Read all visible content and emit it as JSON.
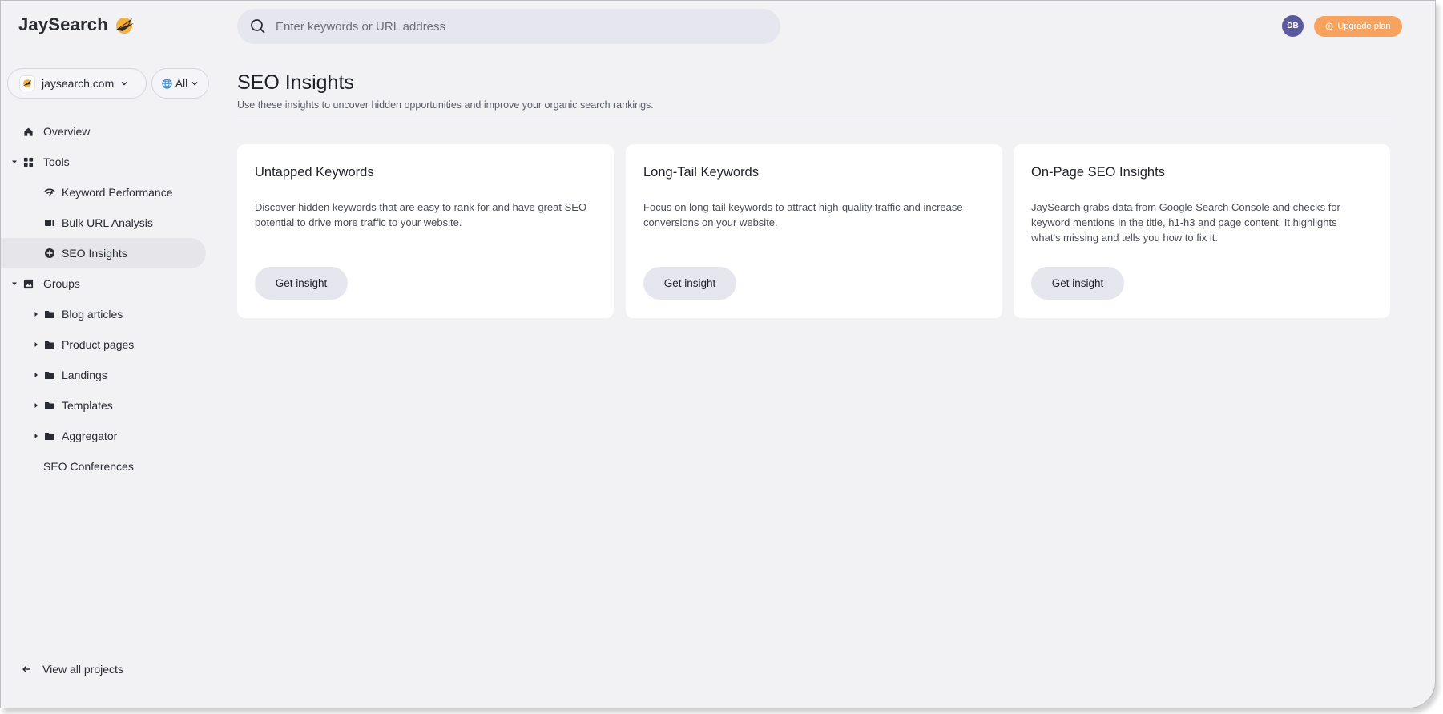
{
  "app": {
    "name": "JaySearch"
  },
  "project_selector": {
    "value": "jaysearch.com"
  },
  "region_selector": {
    "value": "All"
  },
  "search": {
    "placeholder": "Enter keywords or URL address"
  },
  "user": {
    "initials": "DB"
  },
  "upgrade": {
    "label": "Upgrade plan"
  },
  "nav": {
    "overview": "Overview",
    "tools": "Tools",
    "keyword_performance": "Keyword Performance",
    "bulk_url_analysis": "Bulk URL Analysis",
    "seo_insights": "SEO Insights",
    "groups": "Groups",
    "blog_articles": "Blog articles",
    "product_pages": "Product pages",
    "landings": "Landings",
    "templates": "Templates",
    "aggregator": "Aggregator",
    "seo_conferences": "SEO Conferences",
    "view_all_projects": "View all projects"
  },
  "page": {
    "title": "SEO Insights",
    "subtitle": "Use these insights to uncover hidden opportunities and improve your organic search rankings."
  },
  "cards": [
    {
      "title": "Untapped Keywords",
      "description": "Discover hidden keywords that are easy to rank for and have great SEO potential to drive more traffic to your website.",
      "button": "Get insight"
    },
    {
      "title": "Long-Tail Keywords",
      "description": "Focus on long-tail keywords to attract high-quality traffic and increase conversions on your website.",
      "button": "Get insight"
    },
    {
      "title": "On-Page SEO Insights",
      "description": "JaySearch grabs data from Google Search Console and checks for keyword mentions in the title, h1-h3 and page content. It highlights what's missing and tells you how to fix it.",
      "button": "Get insight"
    }
  ],
  "colors": {
    "background": "#f2f2f5",
    "accent_upgrade": "#f7a25e",
    "avatar": "#5b5a9c",
    "active_nav": "#e6e6ea"
  }
}
